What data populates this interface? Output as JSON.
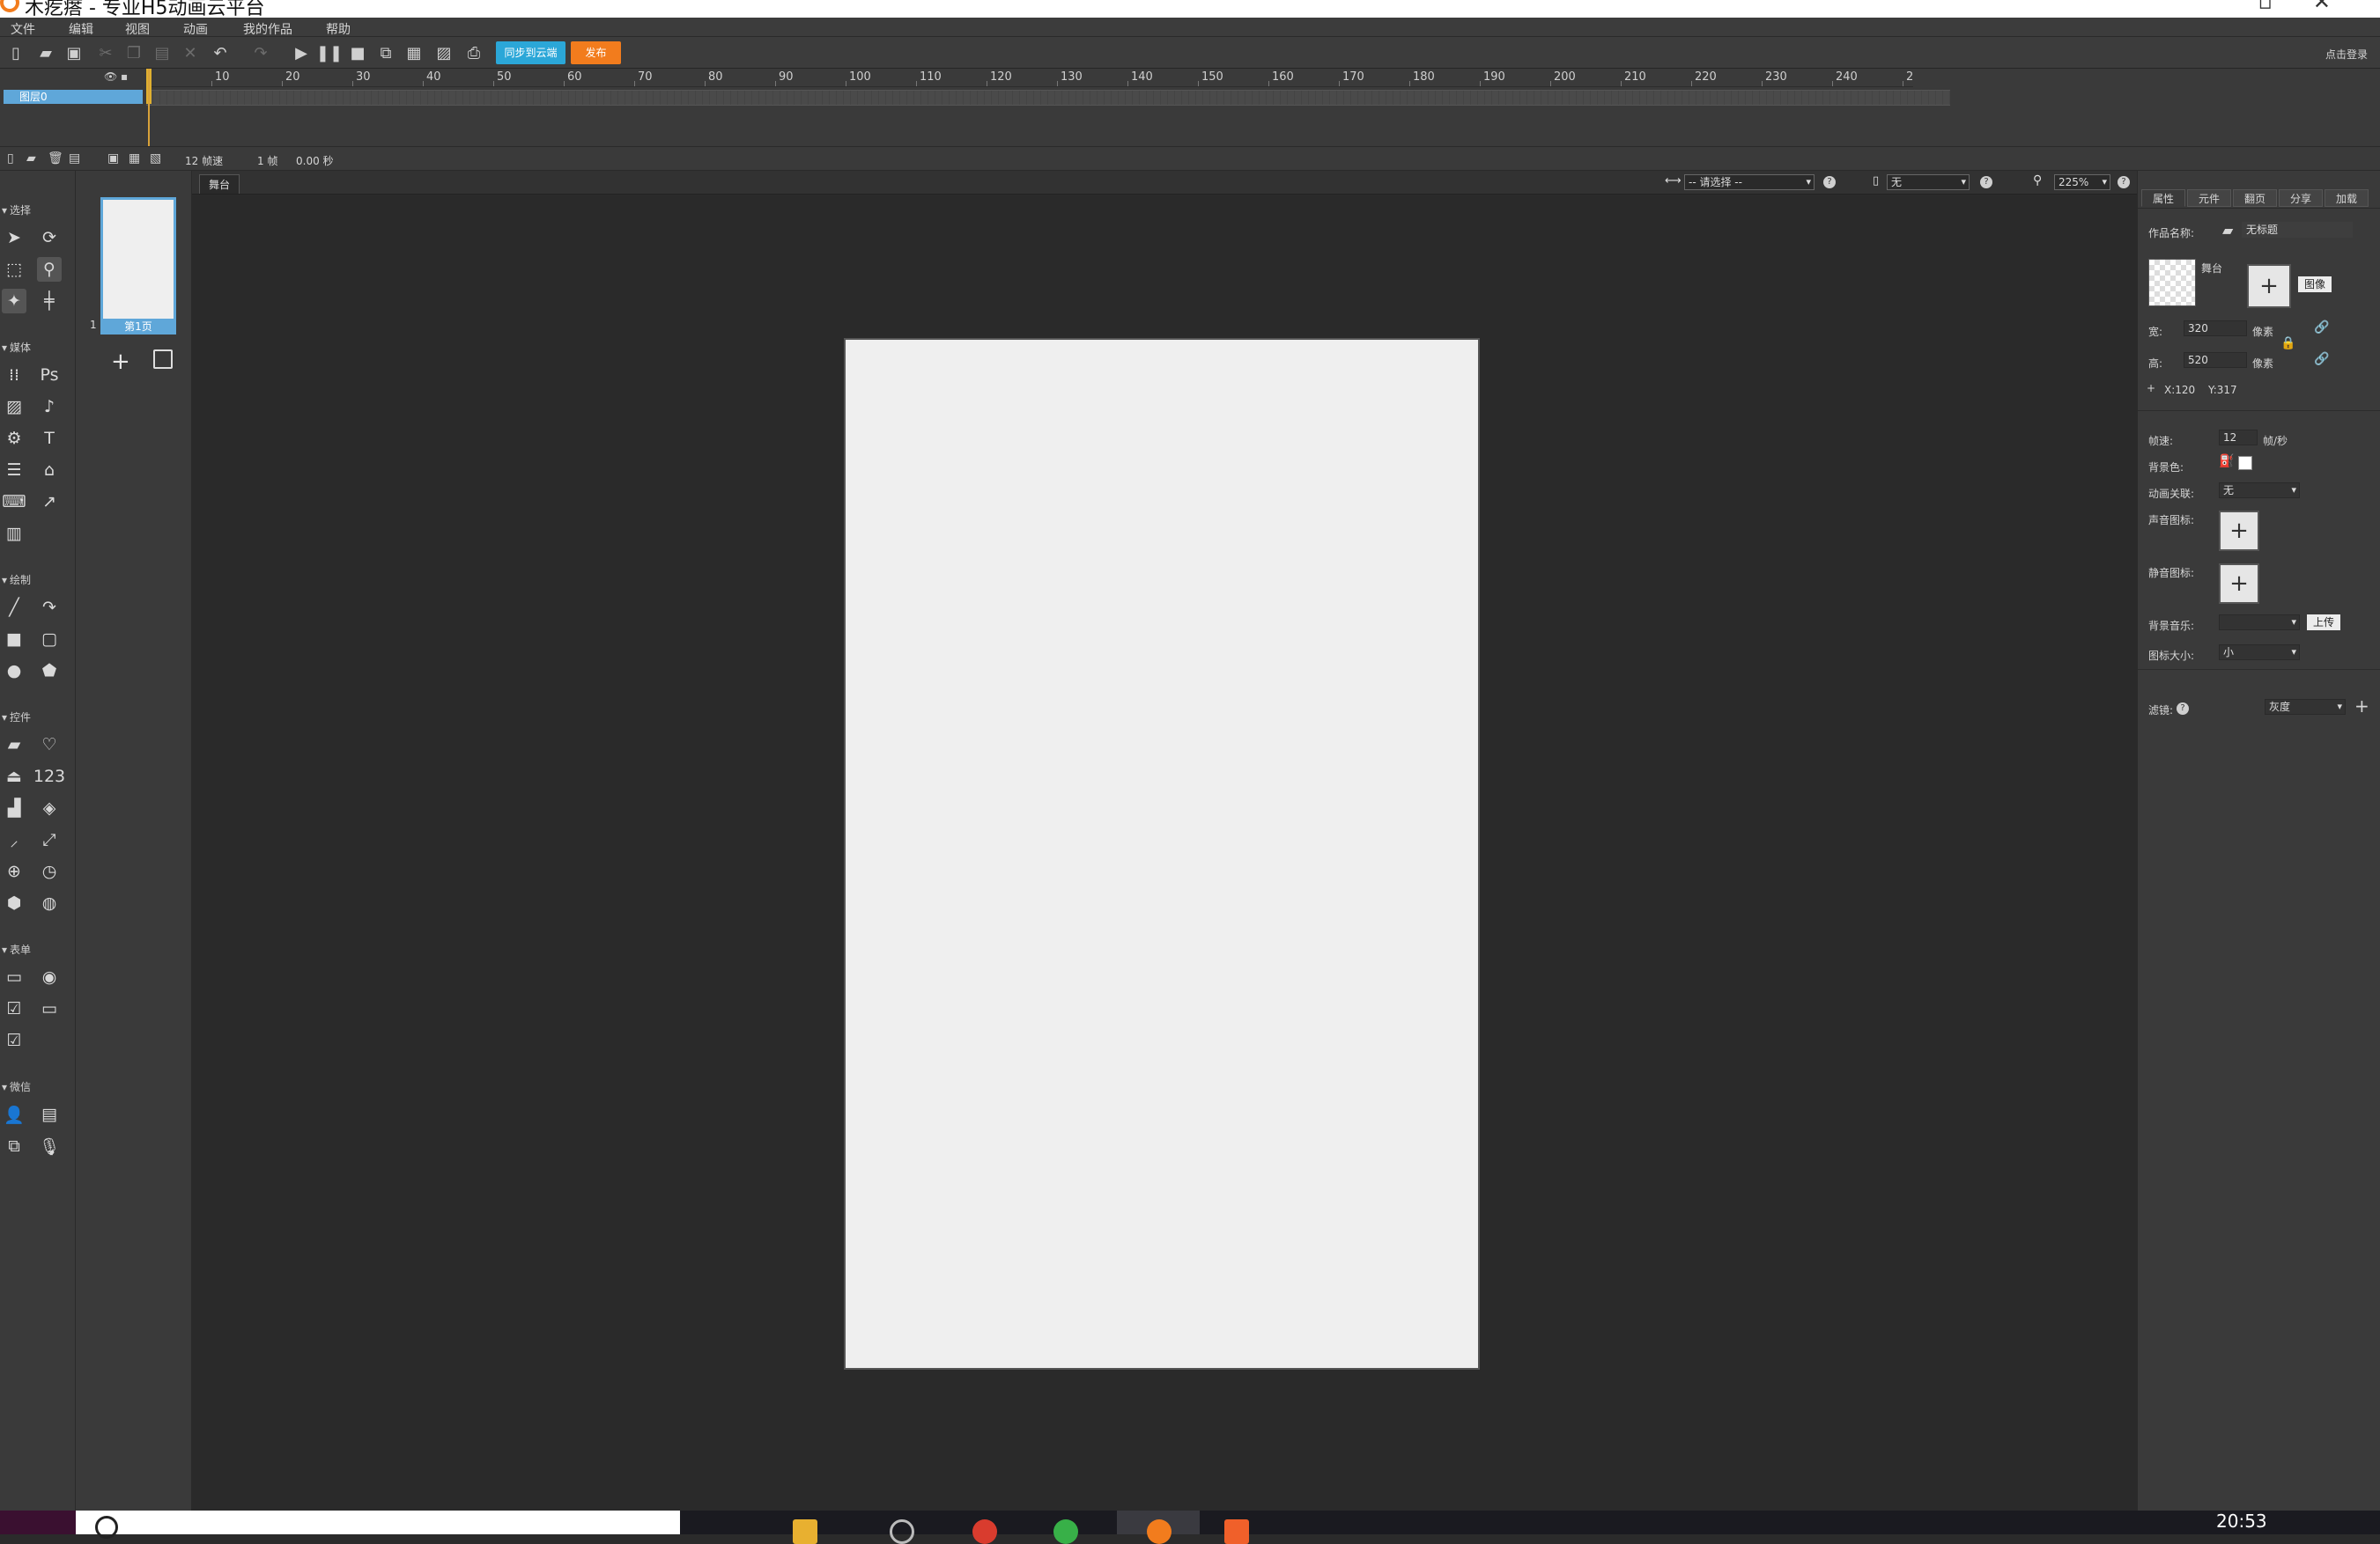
{
  "window": {
    "title": "木疙瘩 - 专业H5动画云平台"
  },
  "menu": [
    "文件",
    "编辑",
    "视图",
    "动画",
    "我的作品",
    "帮助"
  ],
  "toolbar": {
    "sync_label": "同步到云端",
    "publish_label": "发布",
    "login_label": "点击登录"
  },
  "timeline": {
    "ticks": [
      "10",
      "20",
      "30",
      "40",
      "50",
      "60",
      "70",
      "80",
      "90",
      "100",
      "110",
      "120",
      "130",
      "140",
      "150",
      "160",
      "170",
      "180",
      "190",
      "200",
      "210",
      "220",
      "230",
      "240",
      "2"
    ],
    "layer_name": "图层0",
    "fps_label": "12 帧速",
    "frame_label": "1 帧",
    "time_label": "0.00 秒"
  },
  "tools": {
    "groups": [
      "选择",
      "媒体",
      "绘制",
      "控件",
      "表单",
      "微信"
    ],
    "media_ps": "Ps",
    "media_text": "T",
    "control_num": "123"
  },
  "pages": {
    "number": "1",
    "label": "第1页"
  },
  "stage": {
    "tab": "舞台",
    "align_select": "-- 请选择 --",
    "device_select": "无",
    "zoom": "225%"
  },
  "props": {
    "tabs": [
      "属性",
      "元件",
      "翻页",
      "分享",
      "加载"
    ],
    "work_name_label": "作品名称:",
    "work_name_value": "无标题",
    "stage_label": "舞台",
    "image_label": "图像",
    "width_label": "宽:",
    "width_value": "320",
    "height_label": "高:",
    "height_value": "520",
    "unit": "像素",
    "coords_x": "X:120",
    "coords_y": "Y:317",
    "fps_label": "帧速:",
    "fps_value": "12",
    "fps_unit": "帧/秒",
    "bg_color_label": "背景色:",
    "anim_link_label": "动画关联:",
    "anim_link_value": "无",
    "sound_icon_label": "声音图标:",
    "mute_icon_label": "静音图标:",
    "bg_music_label": "背景音乐:",
    "upload_label": "上传",
    "icon_size_label": "图标大小:",
    "icon_size_value": "小",
    "filter_label": "滤镜:",
    "filter_value": "灰度"
  },
  "taskbar": {
    "clock": "20:53"
  },
  "colors": {
    "accent_blue": "#5fa7d9",
    "sync_blue": "#2ba7d8",
    "publish_orange": "#f27c1d",
    "panel": "#3a3a3a",
    "stage_bg": "#2a2a2a",
    "canvas": "#efefef"
  }
}
